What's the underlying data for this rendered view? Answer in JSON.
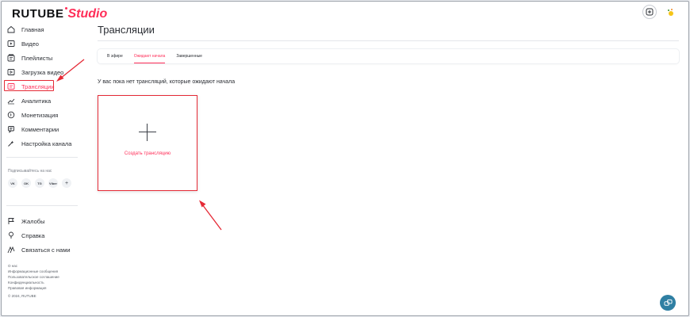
{
  "header": {
    "logo_primary": "RUTUBE",
    "logo_secondary": "Studio"
  },
  "sidebar": {
    "items": [
      {
        "label": "Главная",
        "icon": "home-icon"
      },
      {
        "label": "Видео",
        "icon": "video-icon"
      },
      {
        "label": "Плейлисты",
        "icon": "playlist-icon"
      },
      {
        "label": "Загрузка видео",
        "icon": "upload-icon"
      },
      {
        "label": "Трансляции",
        "icon": "broadcast-icon",
        "active": true
      },
      {
        "label": "Аналитика",
        "icon": "analytics-icon"
      },
      {
        "label": "Монетизация",
        "icon": "monetization-icon"
      },
      {
        "label": "Комментарии",
        "icon": "comments-icon"
      },
      {
        "label": "Настройка канала",
        "icon": "settings-icon"
      }
    ],
    "follow_label": "Подписывайтесь на нас",
    "socials": [
      "VK",
      "OK",
      "TG",
      "Viber",
      "+"
    ],
    "support": [
      {
        "label": "Жалобы",
        "icon": "flag-icon"
      },
      {
        "label": "Справка",
        "icon": "help-icon"
      },
      {
        "label": "Связаться с нами",
        "icon": "contact-icon"
      }
    ],
    "footer_links": [
      "О нас",
      "Информационные сообщения",
      "Пользовательское соглашение",
      "Конфиденциальность",
      "Правовая информация",
      "© 2024, RUTUBE"
    ]
  },
  "main": {
    "title": "Трансляции",
    "tabs": [
      {
        "label": "В эфире"
      },
      {
        "label": "Ожидают начала",
        "active": true
      },
      {
        "label": "Завершенные"
      }
    ],
    "empty_message": "У вас пока нет трансляций, которые ожидают начала",
    "create_card_label": "Создать трансляцию"
  },
  "colors": {
    "accent": "#ff2e58",
    "annotation": "#e52a36",
    "fab": "#2f7fa3"
  }
}
